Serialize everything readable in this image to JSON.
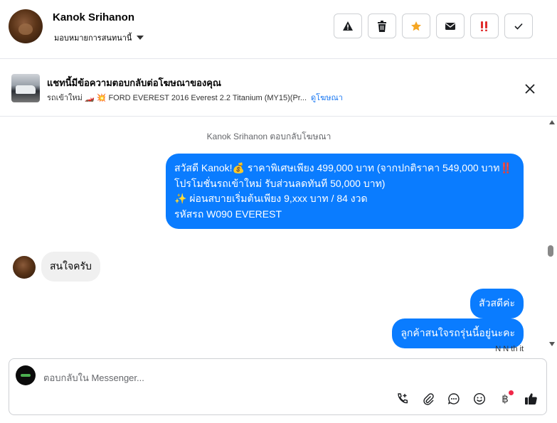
{
  "header": {
    "contact_name": "Kanok Srihanon",
    "assign_label": "มอบหมายการสนทนานี้",
    "actions": [
      "spam-icon",
      "trash-icon",
      "star-icon",
      "mail-icon",
      "priority-icon",
      "check-icon"
    ]
  },
  "ad": {
    "title": "แชทนี้มีข้อความตอบกลับต่อโฆษณาของคุณ",
    "subtitle": "รถเข้าใหม่ 🏎️ 💥 FORD EVEREST 2016 Everest 2.2 Titanium (MY15)(Pr...",
    "link_label": "ดูโฆษณา"
  },
  "chat": {
    "meta_text": "Kanok Srihanon ตอบกลับโฆษณา",
    "messages": {
      "m1": "สวัสดี Kanok!💰 ราคาพิเศษเพียง 499,000 บาท (จากปกติราคา 549,000 บาท‼️ โปรโมชั่นรถเข้าใหม่ รับส่วนลดทันที 50,000 บาท)",
      "m1_line2": "✨ ผ่อนสบายเริ่มต้นเพียง 9,xxx บาท / 84 งวด",
      "m1_line3": "รหัสรถ W090 EVEREST",
      "m2": "สนใจครับ",
      "m3": "สัวสดีค่ะ",
      "m4": "ลูกค้าสนใจรถรุ่นนี้อยู่นะคะ"
    },
    "sender_tag": "N        N    th   it"
  },
  "composer": {
    "placeholder": "ตอบกลับใน Messenger..."
  },
  "colors": {
    "accent": "#0a7cff",
    "star": "#f5a623",
    "priority": "#e02c2c"
  }
}
